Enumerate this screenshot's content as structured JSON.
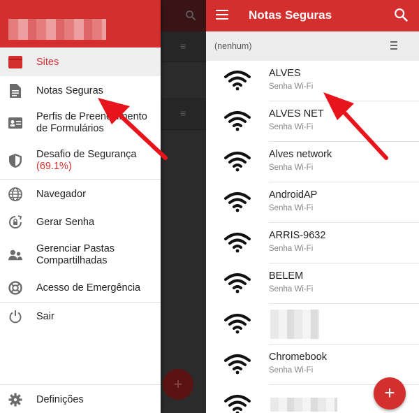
{
  "drawer": {
    "items": [
      {
        "label": "Sites",
        "icon": "browser-window-icon",
        "active": true
      },
      {
        "label": "Notas Seguras",
        "icon": "document-icon",
        "active": false
      },
      {
        "label": "Perfis de Preenchimento de Formulários",
        "icon": "id-card-icon",
        "active": false
      },
      {
        "label": "Desafio de Segurança",
        "sub": "(69.1%)",
        "icon": "shield-icon",
        "active": false
      },
      {
        "label": "Navegador",
        "icon": "globe-icon",
        "active": false
      },
      {
        "label": "Gerar Senha",
        "icon": "refresh-lock-icon",
        "active": false
      },
      {
        "label": "Gerenciar Pastas Compartilhadas",
        "icon": "users-icon",
        "active": false
      },
      {
        "label": "Acesso de Emergência",
        "icon": "lifebuoy-icon",
        "active": false
      },
      {
        "label": "Sair",
        "icon": "power-icon",
        "active": false
      },
      {
        "label": "Definições",
        "icon": "gear-icon",
        "active": false
      }
    ],
    "perfis_line1": "Perfis de Preenchimento",
    "perfis_line2": "de Formulários",
    "pastas_line1": "Gerenciar Pastas",
    "pastas_line2": "Compartilhadas"
  },
  "appbar": {
    "title": "Notas Seguras"
  },
  "folder": {
    "name": "(nenhum)"
  },
  "notes": [
    {
      "title": "ALVES",
      "type": "Senha Wi-Fi"
    },
    {
      "title": "ALVES NET",
      "type": "Senha Wi-Fi"
    },
    {
      "title": "Alves network",
      "type": "Senha Wi-Fi"
    },
    {
      "title": "AndroidAP",
      "type": "Senha Wi-Fi"
    },
    {
      "title": "ARRIS-9632",
      "type": "Senha Wi-Fi"
    },
    {
      "title": "BELEM",
      "type": "Senha Wi-Fi"
    },
    {
      "title": "",
      "type": ""
    },
    {
      "title": "Chromebook",
      "type": "Senha Wi-Fi"
    },
    {
      "title": "",
      "type": ""
    }
  ],
  "fab": {
    "label": "+"
  },
  "colors": {
    "accent": "#d32f2f",
    "arrow": "#e8141c"
  }
}
